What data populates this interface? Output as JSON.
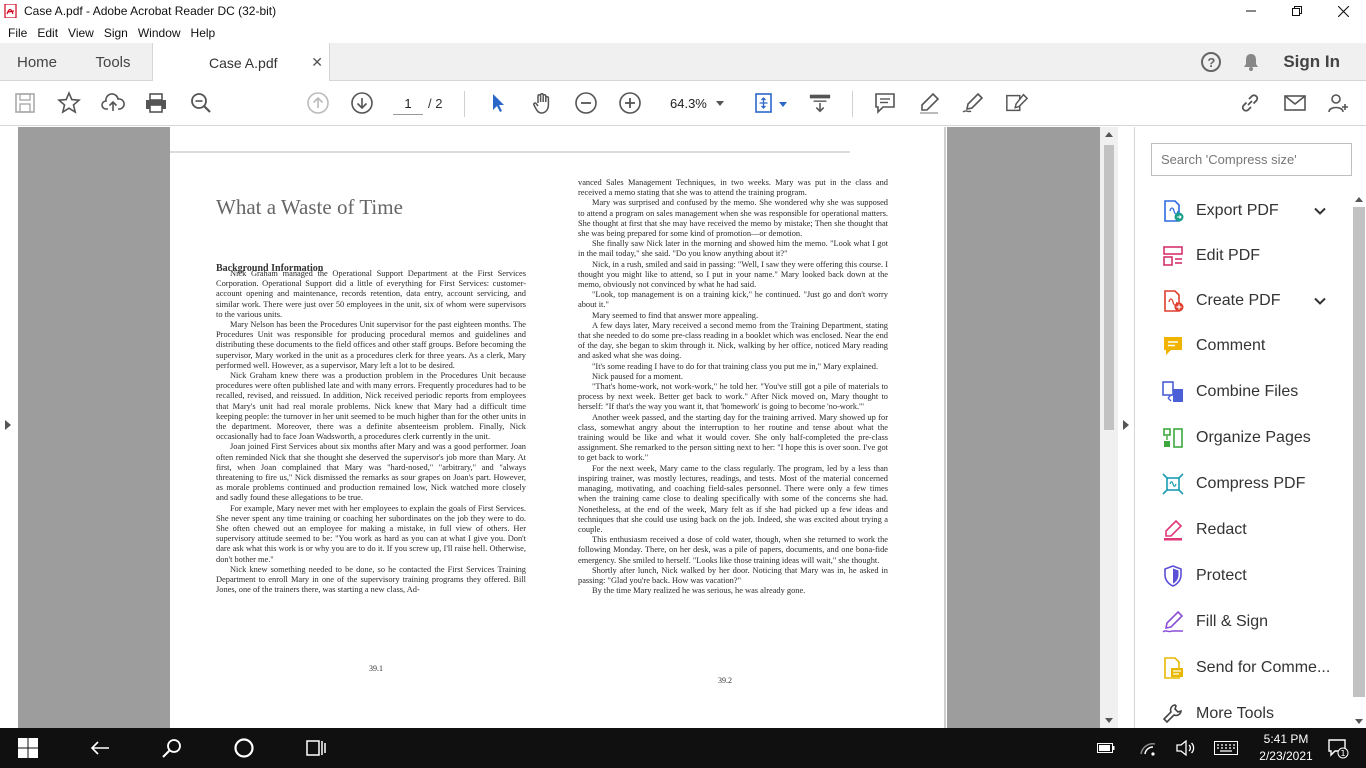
{
  "window": {
    "title": "Case A.pdf - Adobe Acrobat Reader DC (32-bit)"
  },
  "menu": [
    "File",
    "Edit",
    "View",
    "Sign",
    "Window",
    "Help"
  ],
  "tabs": {
    "home": "Home",
    "tools": "Tools",
    "document": "Case A.pdf",
    "sign_in": "Sign In"
  },
  "toolbar": {
    "page_current": "1",
    "page_total": "/ 2",
    "zoom": "64.3%"
  },
  "document": {
    "heading": "What a Waste of Time",
    "subheading": "Background Information",
    "left_paragraphs": [
      "Nick Graham managed the Operational Support Department at the First Services Corporation. Operational Support did a little of everything for First Services: customer-account opening and maintenance, records retention, data entry, account servicing, and similar work. There were just over 50 employees in the unit, six of whom were supervisors to the various units.",
      "Mary Nelson has been the Procedures Unit supervisor for the past eighteen months. The Procedures Unit was responsible for producing procedural memos and guidelines and distributing these documents to the field offices and other staff groups. Before becoming the supervisor, Mary worked in the unit as a procedures clerk for three years. As a clerk, Mary performed well. However, as a supervisor, Mary left a lot to be desired.",
      "Nick Graham knew there was a production problem in the Procedures Unit because procedures were often published late and with many errors. Frequently procedures had to be recalled, revised, and reissued. In addition, Nick received periodic reports from employees that Mary's unit had real morale problems. Nick knew that Mary had a difficult time keeping people: the turnover in her unit seemed to be much higher than for the other units in the department. Moreover, there was a definite absenteeism problem. Finally, Nick occasionally had to face Joan Wadsworth, a procedures clerk currently in the unit.",
      "Joan joined First Services about six months after Mary and was a good performer. Joan often reminded Nick that she thought she deserved the supervisor's job more than Mary. At first, when Joan complained that Mary was \"hard-nosed,\" \"arbitrary,\" and \"always threatening to fire us,\" Nick dismissed the remarks as sour grapes on Joan's part. However, as morale problems continued and production remained low, Nick watched more closely and sadly found these allegations to be true.",
      "For example, Mary never met with her employees to explain the goals of First Services. She never spent any time training or coaching her subordinates on the job they were to do. She often chewed out an employee for making a mistake, in full view of others. Her supervisory attitude seemed to be: \"You work as hard as you can at what I give you. Don't dare ask what this work is or why you are to do it. If you screw up, I'll raise hell. Otherwise, don't bother me.\"",
      "Nick knew something needed to be done, so he contacted the First Services Training Department to enroll Mary in one of the supervisory training programs they offered. Bill Jones, one of the trainers there, was starting a new class, Ad-"
    ],
    "right_paragraphs": [
      "vanced Sales Management Techniques, in two weeks. Mary was put in the class and received a memo stating that she was to attend the training program.",
      "Mary was surprised and confused by the memo. She wondered why she was supposed to attend a program on sales management when she was responsible for operational matters. She thought at first that she may have received the memo by mistake; Then she thought that she was being prepared for some kind of promotion—or demotion.",
      "She finally saw Nick later in the morning and showed him the memo. \"Look what I got in the mail today,\" she said. \"Do you know anything about it?\"",
      "Nick, in a rush, smiled and said in passing: \"Well, I saw they were offering this course. I thought you might like to attend, so I put in your name.\" Mary looked back down at the memo, obviously not convinced by what he had said.",
      "\"Look, top management is on a training kick,\" he continued. \"Just go and don't worry about it.\"",
      "Mary seemed to find that answer more appealing.",
      "A few days later, Mary received a second memo from the Training Department, stating that she needed to do some pre-class reading in a booklet which was enclosed. Near the end of the day, she began to skim through it. Nick, walking by her office, noticed Mary reading and asked what she was doing.",
      "\"It's some reading I have to do for that training class you put me in,\" Mary explained.",
      "Nick paused for a moment.",
      "\"That's home-work, not work-work,\" he told her. \"You've still got a pile of materials to process by next week. Better get back to work.\" After Nick moved on, Mary thought to herself: \"If that's the way you want it, that 'homework' is going to become 'no-work.'\"",
      "Another week passed, and the starting day for the training arrived. Mary showed up for class, somewhat angry about the interruption to her routine and tense about what the training would be like and what it would cover. She only half-completed the pre-class assignment. She remarked to the person sitting next to her: \"I hope this is over soon. I've got to get back to work.\"",
      "For the next week, Mary came to the class regularly. The program, led by a less than inspiring trainer, was mostly lectures, readings, and tests. Most of the material concerned managing, motivating, and coaching field-sales personnel. There were only a few times when the training came close to dealing specifically with some of the concerns she had. Nonetheless, at the end of the week, Mary felt as if she had picked up a few ideas and techniques that she could use using back on the job. Indeed, she was excited about trying a couple.",
      "This enthusiasm received a dose of cold water, though, when she returned to work the following Monday. There, on her desk, was a pile of papers, documents, and one bona-fide emergency. She smiled to herself. \"Looks like those training ideas will wait,\" she thought.",
      "Shortly after lunch, Nick walked by her door. Noticing that Mary was in, he asked in passing: \"Glad you're back. How was vacation?\"",
      "By the time Mary realized he was serious, he was already gone."
    ],
    "page_left_num": "39.1",
    "page_right_num": "39.2"
  },
  "tools_pane": {
    "search_placeholder": "Search 'Compress size'",
    "items": [
      {
        "label": "Export PDF",
        "icon": "export-pdf-icon",
        "color": "#2d6ae0",
        "chevron": true
      },
      {
        "label": "Edit PDF",
        "icon": "edit-pdf-icon",
        "color": "#d6326e",
        "chevron": false
      },
      {
        "label": "Create PDF",
        "icon": "create-pdf-icon",
        "color": "#e03e2d",
        "chevron": true
      },
      {
        "label": "Comment",
        "icon": "comment-icon",
        "color": "#f0b400",
        "chevron": false
      },
      {
        "label": "Combine Files",
        "icon": "combine-files-icon",
        "color": "#4b5fd6",
        "chevron": false
      },
      {
        "label": "Organize Pages",
        "icon": "organize-pages-icon",
        "color": "#3ea83e",
        "chevron": false
      },
      {
        "label": "Compress PDF",
        "icon": "compress-pdf-icon",
        "color": "#1a9fb5",
        "chevron": false
      },
      {
        "label": "Redact",
        "icon": "redact-icon",
        "color": "#e0367a",
        "chevron": false
      },
      {
        "label": "Protect",
        "icon": "protect-icon",
        "color": "#5b4fd6",
        "chevron": false
      },
      {
        "label": "Fill & Sign",
        "icon": "fill-sign-icon",
        "color": "#8a4fd6",
        "chevron": false
      },
      {
        "label": "Send for Comme...",
        "icon": "send-for-comment-icon",
        "color": "#e8b800",
        "chevron": false
      },
      {
        "label": "More Tools",
        "icon": "more-tools-icon",
        "color": "#444444",
        "chevron": false
      }
    ]
  },
  "taskbar": {
    "time": "5:41 PM",
    "date": "2/23/2021",
    "notification_count": "1"
  }
}
